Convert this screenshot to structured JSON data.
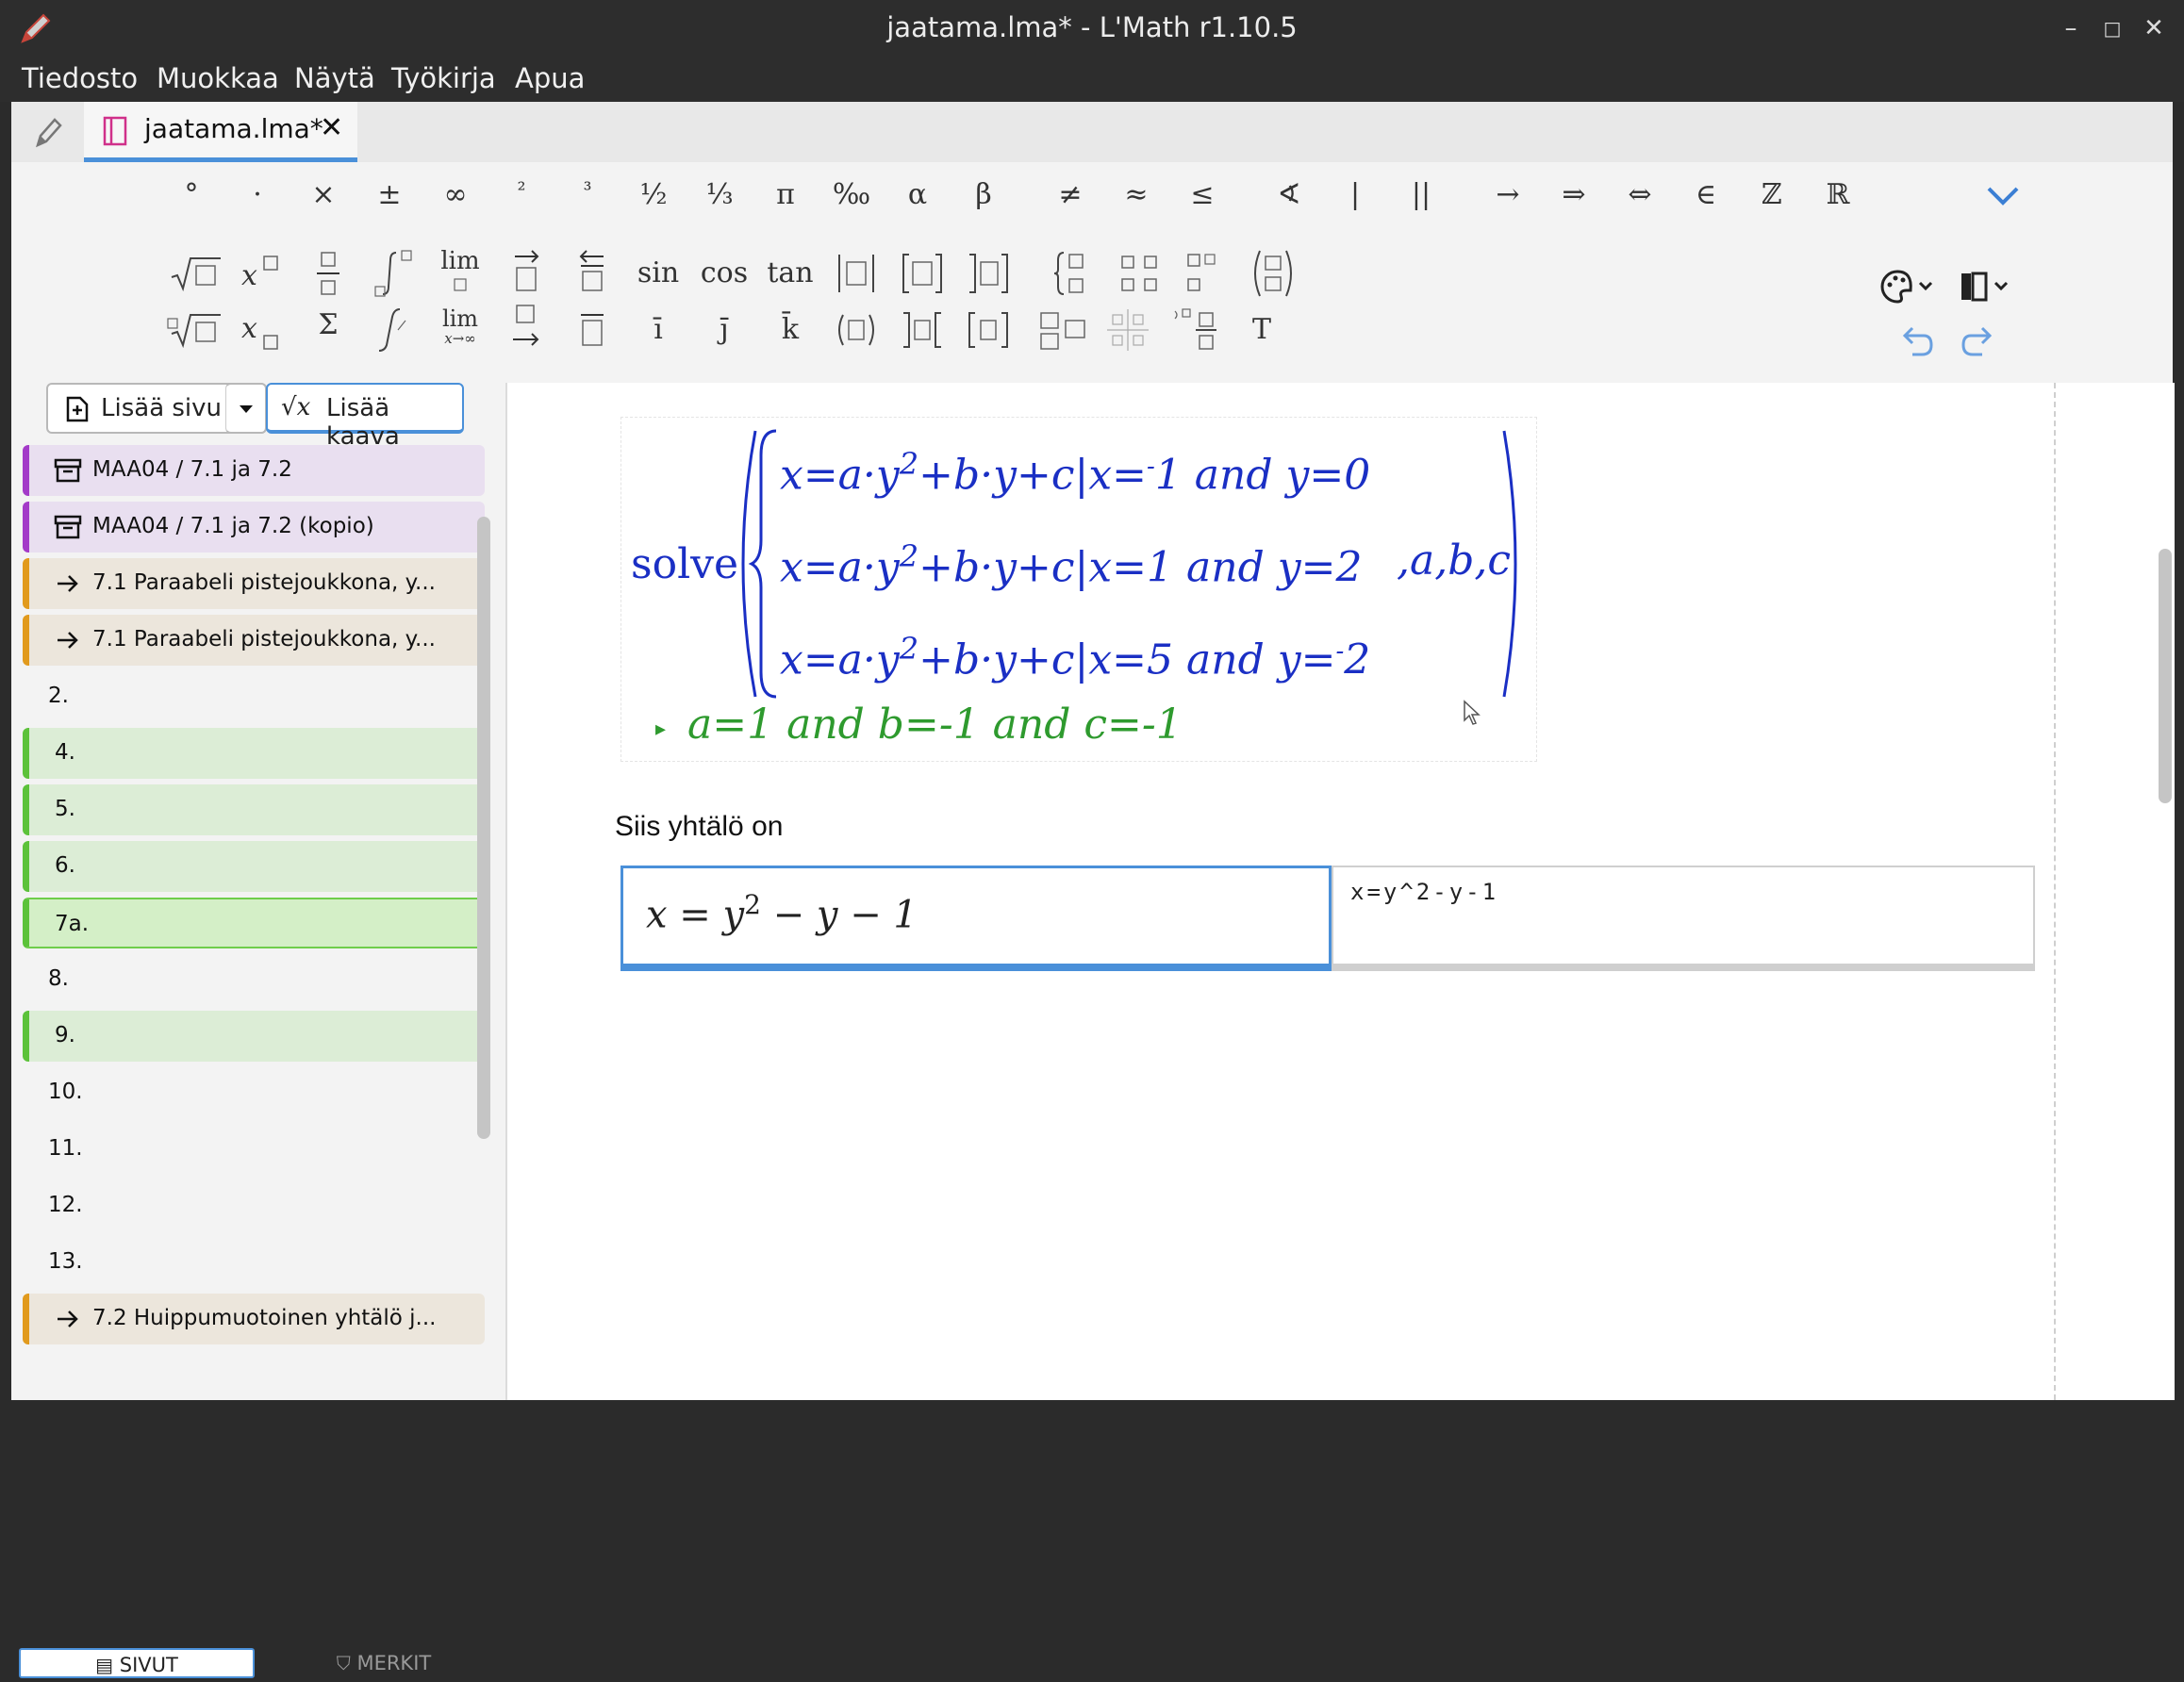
{
  "window": {
    "title": "jaatama.lma* - L'Math r1.10.5"
  },
  "menu": [
    "Tiedosto",
    "Muokkaa",
    "Näytä",
    "Työkirja",
    "Apua"
  ],
  "tab": {
    "label": "jaatama.lma*",
    "close": "✕"
  },
  "toolbar": {
    "row1": [
      "°",
      "·",
      "×",
      "±",
      "∞",
      "²",
      "³",
      "½",
      "⅓",
      "π",
      "‰",
      "α",
      "β",
      "≠",
      "≈",
      "≤",
      "∢",
      "|",
      "||",
      "→",
      "⇒",
      "⇔",
      "∈",
      "ℤ",
      "ℝ"
    ],
    "row2_text": [
      "lim",
      "sin",
      "cos",
      "tan"
    ],
    "row3_text": [
      "lim",
      "x→∞",
      "T",
      "Σ",
      "ī",
      "j̄",
      "k̄"
    ]
  },
  "sidebar": {
    "add_page": "Lisää sivu",
    "add_formula": "Lisää kaava",
    "pages": [
      {
        "label": "MAA04 / 7.1 ja 7.2",
        "style": "purple",
        "icon": "archive"
      },
      {
        "label": "MAA04 / 7.1 ja 7.2 (kopio)",
        "style": "purple",
        "icon": "archive"
      },
      {
        "label": "7.1 Paraabeli pistejoukkona, y...",
        "style": "orange",
        "icon": "arrow"
      },
      {
        "label": "7.1 Paraabeli pistejoukkona, y...",
        "style": "orange",
        "icon": "arrow"
      },
      {
        "label": "2.",
        "style": "plain",
        "icon": ""
      },
      {
        "label": "4.",
        "style": "green",
        "icon": ""
      },
      {
        "label": "5.",
        "style": "green",
        "icon": ""
      },
      {
        "label": "6.",
        "style": "green",
        "icon": ""
      },
      {
        "label": "7a.",
        "style": "green-sel",
        "icon": ""
      },
      {
        "label": "8.",
        "style": "plain",
        "icon": ""
      },
      {
        "label": "9.",
        "style": "green",
        "icon": ""
      },
      {
        "label": "10.",
        "style": "plain",
        "icon": ""
      },
      {
        "label": "11.",
        "style": "plain",
        "icon": ""
      },
      {
        "label": "12.",
        "style": "plain",
        "icon": ""
      },
      {
        "label": "13.",
        "style": "plain",
        "icon": ""
      },
      {
        "label": "7.2 Huippumuotoinen yhtälö j...",
        "style": "orange",
        "icon": "arrow"
      }
    ],
    "tab_pages": "SIVUT",
    "tab_marks": "MERKIT"
  },
  "content": {
    "solve": {
      "word": "solve",
      "rows": [
        {
          "eq": "x=a·y",
          "sup": "2",
          "rest": "+b·y+c|x=",
          "neg": "-",
          "val": "1 and y=0"
        },
        {
          "eq": "x=a·y",
          "sup": "2",
          "rest": "+b·y+c|x=1 and y=2",
          "neg": "",
          "val": ""
        },
        {
          "eq": "x=a·y",
          "sup": "2",
          "rest": "+b·y+c|x=5 and y=",
          "neg": "-",
          "val": "2"
        }
      ],
      "vars": ",a,b,c",
      "result": "a=1 and b=-1 and c=-1"
    },
    "text": "Siis yhtälö on",
    "formula_rendered_lhs": "x = y",
    "formula_rendered_sup": "2",
    "formula_rendered_rhs": " − y − 1",
    "formula_source": "x=y^2-y-1"
  },
  "colors": {
    "accent": "#4a90d9",
    "solve_blue": "#1a2fc4",
    "result_green": "#2e9a2e"
  }
}
